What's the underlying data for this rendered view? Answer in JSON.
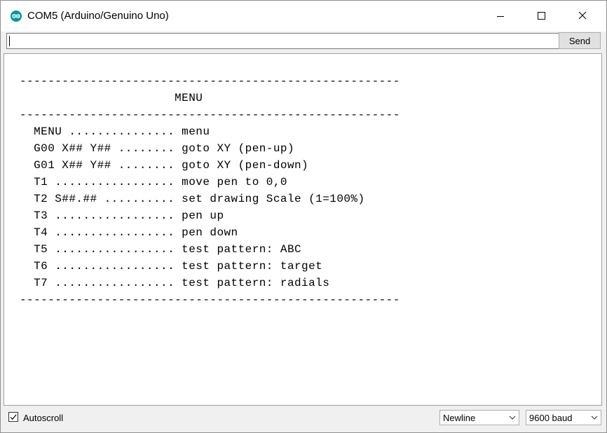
{
  "window": {
    "title": "COM5 (Arduino/Genuino Uno)",
    "accent_color": "#00979c",
    "icons": {
      "app": "arduino-icon",
      "minimize": "minimize-icon",
      "maximize": "maximize-icon",
      "close": "close-icon"
    }
  },
  "input": {
    "value": "",
    "send_label": "Send"
  },
  "output": {
    "lines": [
      "------------------------------------------------------",
      "                      MENU",
      "------------------------------------------------------",
      "  MENU ............... menu",
      "  G00 X## Y## ........ goto XY (pen-up)",
      "  G01 X## Y## ........ goto XY (pen-down)",
      "  T1 ................. move pen to 0,0",
      "  T2 S##.## .......... set drawing Scale (1=100%)",
      "  T3 ................. pen up",
      "  T4 ................. pen down",
      "  T5 ................. test pattern: ABC",
      "  T6 ................. test pattern: target",
      "  T7 ................. test pattern: radials",
      "------------------------------------------------------"
    ]
  },
  "statusbar": {
    "autoscroll_label": "Autoscroll",
    "autoscroll_checked": true,
    "line_ending": "Newline",
    "baud_rate": "9600 baud"
  }
}
